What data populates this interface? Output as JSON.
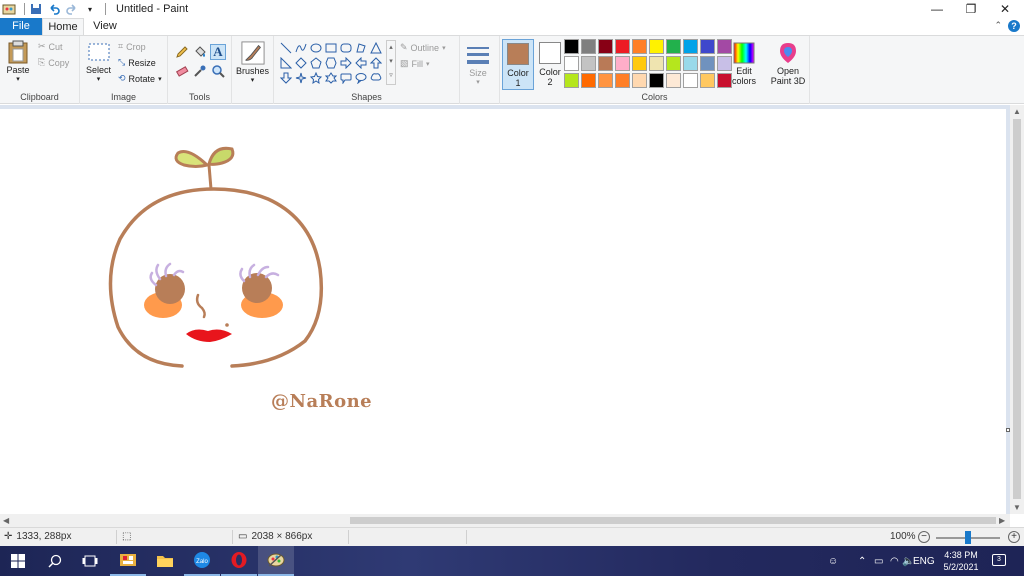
{
  "window": {
    "title": "Untitled - Paint",
    "minimize_icon": "minimize-icon",
    "maximize_icon": "restore-icon",
    "close_icon": "close-icon"
  },
  "tabs": {
    "file": "File",
    "home": "Home",
    "view": "View"
  },
  "ribbon": {
    "clipboard": {
      "label": "Clipboard",
      "paste": "Paste",
      "cut": "Cut",
      "copy": "Copy"
    },
    "image": {
      "label": "Image",
      "select": "Select",
      "crop": "Crop",
      "resize": "Resize",
      "rotate": "Rotate"
    },
    "tools": {
      "label": "Tools"
    },
    "brushes": {
      "label": "Brushes"
    },
    "shapes": {
      "label": "Shapes",
      "outline": "Outline",
      "fill": "Fill"
    },
    "size": {
      "label": "Size"
    },
    "colors": {
      "label": "Colors",
      "color1_label": "Color",
      "color1_num": "1",
      "color2_label": "Color",
      "color2_num": "2",
      "color1_value": "#b87e58",
      "color2_value": "#ffffff",
      "edit_label": "Edit",
      "edit_label2": "colors",
      "palette": [
        "#000000",
        "#7f7f7f",
        "#880015",
        "#ed1c24",
        "#ff7f27",
        "#fff200",
        "#22b14c",
        "#00a2e8",
        "#3f48cc",
        "#a349a4",
        "#ffffff",
        "#c3c3c3",
        "#b97a57",
        "#ffaec9",
        "#ffc90e",
        "#efe4b0",
        "#b5e61d",
        "#99d9ea",
        "#7092be",
        "#c8bfe7",
        "#b5e61d",
        "#ff6a00",
        "#ff9440",
        "#ff7f27",
        "#ffd8b0",
        "#000000",
        "#fde9d6",
        "#ffffff",
        "#ffc860",
        "#c8102e"
      ]
    },
    "paint3d": {
      "label1": "Open",
      "label2": "Paint 3D"
    }
  },
  "canvas": {
    "watermark": "@NaRone"
  },
  "statusbar": {
    "cursor_pos": "1333, 288px",
    "canvas_size": "2038 × 866px",
    "zoom": "100%"
  },
  "taskbar": {
    "time": "4:38 PM",
    "date": "5/2/2021",
    "language": "ENG",
    "notification_count": "3",
    "apps": [
      "start-icon",
      "search-icon",
      "task-view-icon",
      "photos-icon",
      "file-explorer-icon",
      "zalo-icon",
      "opera-icon",
      "paint-icon"
    ]
  }
}
